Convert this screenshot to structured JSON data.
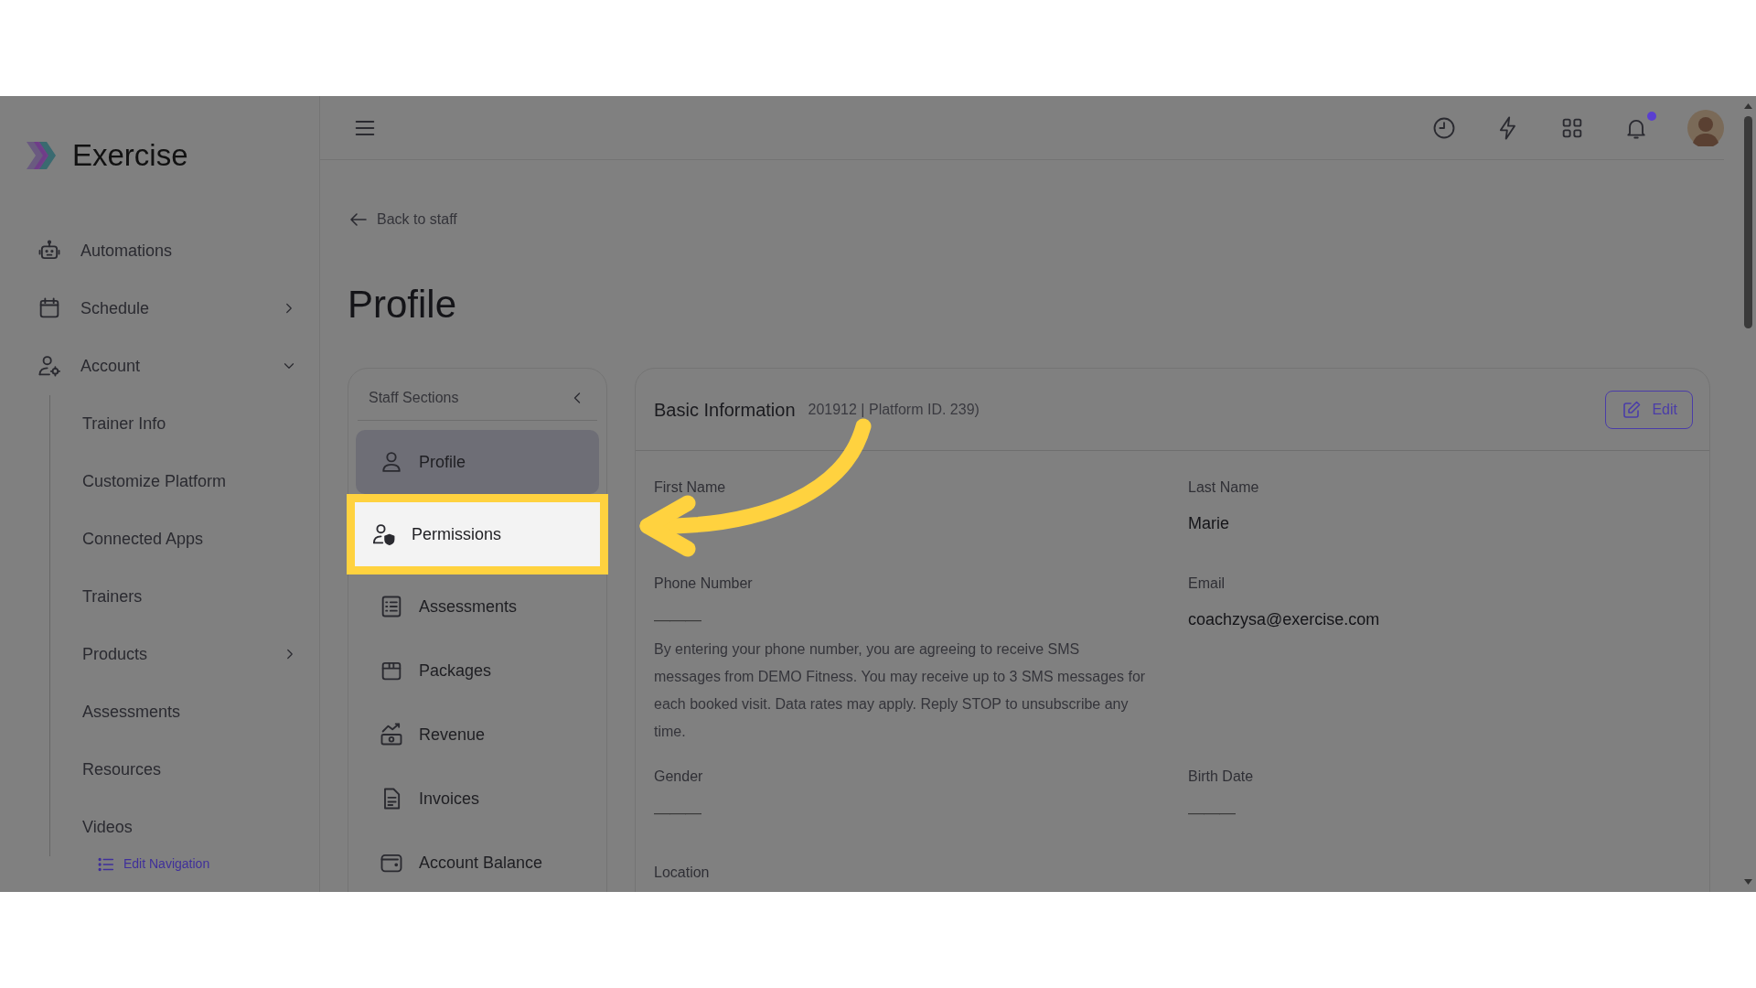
{
  "brand": {
    "name": "Exercise"
  },
  "sidebar": {
    "items": [
      {
        "label": "Automations",
        "kind": "link"
      },
      {
        "label": "Schedule",
        "kind": "group",
        "expanded": false
      },
      {
        "label": "Account",
        "kind": "group",
        "expanded": true,
        "children": [
          {
            "label": "Trainer Info",
            "kind": "link"
          },
          {
            "label": "Customize Platform",
            "kind": "link"
          },
          {
            "label": "Connected Apps",
            "kind": "link"
          },
          {
            "label": "Trainers",
            "kind": "link"
          },
          {
            "label": "Products",
            "kind": "group",
            "expanded": false
          },
          {
            "label": "Assessments",
            "kind": "link"
          },
          {
            "label": "Resources",
            "kind": "link"
          },
          {
            "label": "Videos",
            "kind": "link"
          }
        ]
      }
    ],
    "edit_link": "Edit Navigation"
  },
  "topbar": {
    "notifications_unread": true
  },
  "back_link": "Back to staff",
  "page_title": "Profile",
  "staff_sections": {
    "title": "Staff Sections",
    "items": [
      {
        "label": "Profile",
        "selected": true,
        "highlighted": false
      },
      {
        "label": "Permissions",
        "selected": false,
        "highlighted": true
      },
      {
        "label": "Assessments",
        "selected": false,
        "highlighted": false
      },
      {
        "label": "Packages",
        "selected": false,
        "highlighted": false
      },
      {
        "label": "Revenue",
        "selected": false,
        "highlighted": false
      },
      {
        "label": "Invoices",
        "selected": false,
        "highlighted": false
      },
      {
        "label": "Account Balance",
        "selected": false,
        "highlighted": false
      }
    ]
  },
  "basic_info": {
    "title": "Basic Information",
    "subtitle": "201912 | Platform ID. 239)",
    "edit_button": "Edit",
    "fields": [
      {
        "label": "First Name"
      },
      {
        "label": "Last Name",
        "value": "Marie",
        "empty": false
      },
      {
        "label": "Phone Number",
        "value": "———",
        "empty": true,
        "note": "By entering your phone number, you are agreeing to receive SMS messages from DEMO Fitness. You may receive up to 3 SMS messages for each booked visit. Data rates may apply. Reply STOP to unsubscribe any time."
      },
      {
        "label": "Email",
        "value": "coachzysa@exercise.com",
        "empty": false
      },
      {
        "label": "Gender",
        "value": "———",
        "empty": true
      },
      {
        "label": "Birth Date",
        "value": "———",
        "empty": true
      },
      {
        "label": "Location"
      }
    ]
  }
}
